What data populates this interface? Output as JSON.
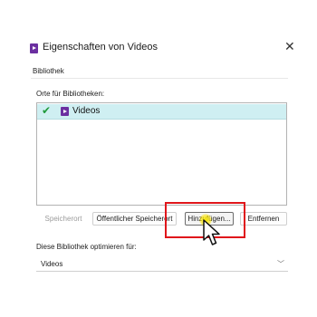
{
  "window": {
    "title": "Eigenschaften von Videos",
    "close_glyph": "✕"
  },
  "tab": {
    "label": "Bibliothek"
  },
  "locations": {
    "label": "Orte für Bibliotheken:",
    "items": [
      {
        "label": "Videos",
        "checked": true,
        "icon": "video-library-icon"
      }
    ]
  },
  "buttons": {
    "storage_label": "Speicherort",
    "public_label": "Öffentlicher Speicherort",
    "add_label": "Hinzufügen...",
    "remove_label": "Entfernen"
  },
  "optimize": {
    "label": "Diese Bibliothek optimieren für:",
    "value": "Videos"
  },
  "colors": {
    "highlight": "#e0161b",
    "selection": "#cfeff2",
    "video_icon": "#6b2fa0"
  }
}
